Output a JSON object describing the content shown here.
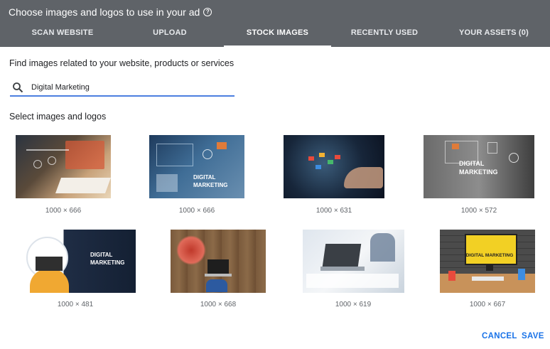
{
  "dialog": {
    "title": "Choose images and logos to use in your ad",
    "help_icon": "help-circle-icon"
  },
  "tabs": [
    {
      "label": "SCAN WEBSITE",
      "active": false
    },
    {
      "label": "UPLOAD",
      "active": false
    },
    {
      "label": "STOCK IMAGES",
      "active": true
    },
    {
      "label": "RECENTLY USED",
      "active": false
    },
    {
      "label": "YOUR ASSETS (0)",
      "active": false
    }
  ],
  "search": {
    "instruction": "Find images related to your website, products or services",
    "value": "Digital Marketing",
    "icon": "search-icon"
  },
  "images_section": {
    "label": "Select images and logos",
    "images": [
      {
        "dims": "1000 × 666"
      },
      {
        "dims": "1000 × 666",
        "overlay": "DIGITAL\nMARKETING"
      },
      {
        "dims": "1000 × 631"
      },
      {
        "dims": "1000 × 572",
        "overlay": "DIGITAL\nMARKETING"
      },
      {
        "dims": "1000 × 481",
        "overlay": "DIGITAL\nMARKETING"
      },
      {
        "dims": "1000 × 668"
      },
      {
        "dims": "1000 × 619"
      },
      {
        "dims": "1000 × 667",
        "overlay": "DIGITAL MARKETING"
      }
    ]
  },
  "actions": {
    "cancel": "CANCEL",
    "save": "SAVE"
  },
  "colors": {
    "header": "#5f6368",
    "accent": "#1a73e8",
    "search_underline": "#4c7fe0"
  }
}
